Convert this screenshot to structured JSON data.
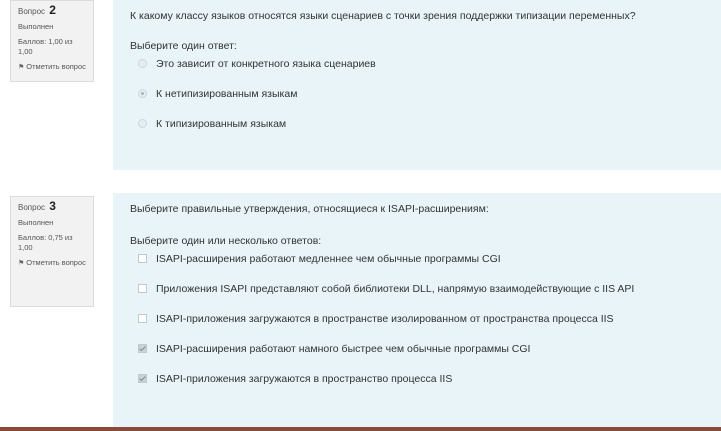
{
  "questions": [
    {
      "label": "Вопрос",
      "number": "2",
      "status": "Выполнен",
      "grade": "Баллов: 1,00 из 1,00",
      "flag_label": "Отметить вопрос",
      "text": "К какому классу языков относятся языки сценариев с точки зрения поддержки типизации переменных?",
      "prompt": "Выберите один ответ:",
      "answers": [
        {
          "label": "Это зависит от конкретного языка сценариев",
          "checked": false
        },
        {
          "label": "К нетипизированным языкам",
          "checked": true
        },
        {
          "label": "К типизированным языкам",
          "checked": false
        }
      ]
    },
    {
      "label": "Вопрос",
      "number": "3",
      "status": "Выполнен",
      "grade": "Баллов: 0,75 из 1,00",
      "flag_label": "Отметить вопрос",
      "text": "Выберите правильные утверждения, относящиеся к ISAPI-расширениям:",
      "prompt": "Выберите один или несколько ответов:",
      "answers": [
        {
          "label": "ISAPI-расширения работают медленнее чем обычные программы CGI",
          "checked": false
        },
        {
          "label": "Приложения ISAPI представляют собой библиотеки DLL, напрямую взаимодействующие с IIS API",
          "checked": false
        },
        {
          "label": "ISAPI-приложения загружаются в пространстве изолированном от пространства процесса IIS",
          "checked": false
        },
        {
          "label": "ISAPI-расширения работают намного быстрее чем обычные программы CGI",
          "checked": true
        },
        {
          "label": "ISAPI-приложения загружаются в пространство процесса IIS",
          "checked": true
        }
      ]
    }
  ],
  "colors": {
    "info_bg": "#f2f2f2",
    "content_bg": "#e8f4f8",
    "text": "#333333"
  },
  "icons": {
    "flag": "flag-icon"
  }
}
